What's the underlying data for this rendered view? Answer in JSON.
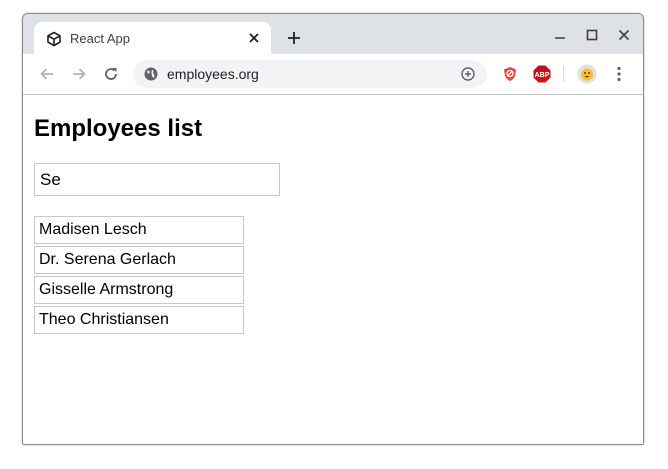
{
  "browser": {
    "tab": {
      "title": "React App",
      "favicon": "cube-icon",
      "close_icon": "close-icon"
    },
    "new_tab_icon": "plus-icon",
    "window_controls": [
      "minimize-icon",
      "maximize-icon",
      "close-icon"
    ],
    "nav": [
      "back-arrow-icon",
      "forward-arrow-icon",
      "reload-icon"
    ],
    "address_bar": {
      "url": "employees.org",
      "site_icon": "globe-icon",
      "action_icon": "add-circle-icon"
    },
    "extensions": [
      {
        "name": "shield-extension-icon",
        "color": "#e8453c"
      },
      {
        "name": "adblock-plus-icon",
        "label": "ABP",
        "color": "#c4121b"
      }
    ],
    "profile_icon": "profile-avatar-icon",
    "menu_icon": "kebab-menu-icon"
  },
  "page": {
    "title": "Employees list",
    "search": {
      "value": "Se",
      "placeholder": ""
    },
    "employees": [
      "Madisen Lesch",
      "Dr. Serena Gerlach",
      "Gisselle Armstrong",
      "Theo Christiansen"
    ]
  },
  "colors": {
    "tabstrip": "#dee1e6",
    "omnibox": "#f1f3f4",
    "border": "#c8c8c8"
  }
}
